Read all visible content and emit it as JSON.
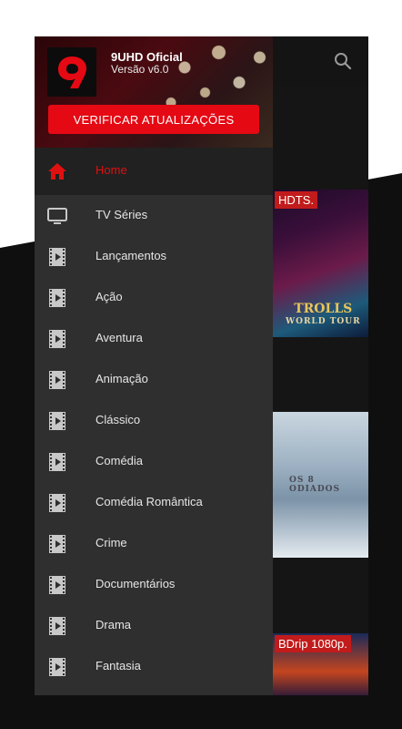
{
  "app": {
    "name": "9UHD Oficial",
    "version": "Versão v6.0",
    "update_button": "VERIFICAR ATUALIZAÇÕES"
  },
  "menu": {
    "items": [
      {
        "label": "Home",
        "icon": "home-icon",
        "active": true
      },
      {
        "label": "TV Séries",
        "icon": "tv-icon"
      },
      {
        "label": "Lançamentos",
        "icon": "film-icon"
      },
      {
        "label": "Ação",
        "icon": "film-icon"
      },
      {
        "label": "Aventura",
        "icon": "film-icon"
      },
      {
        "label": "Animação",
        "icon": "film-icon"
      },
      {
        "label": "Clássico",
        "icon": "film-icon"
      },
      {
        "label": "Comédia",
        "icon": "film-icon"
      },
      {
        "label": "Comédia Romântica",
        "icon": "film-icon"
      },
      {
        "label": "Crime",
        "icon": "film-icon"
      },
      {
        "label": "Documentários",
        "icon": "film-icon"
      },
      {
        "label": "Drama",
        "icon": "film-icon"
      },
      {
        "label": "Fantasia",
        "icon": "film-icon"
      }
    ]
  },
  "posters": [
    {
      "badge": "HDTS.",
      "title": "TROLLS",
      "subtitle": "WORLD TOUR"
    },
    {
      "badge": "",
      "title": "OS 8 ODIADOS"
    },
    {
      "badge": "BDrip 1080p."
    }
  ],
  "colors": {
    "accent": "#e50914",
    "active": "#e01010",
    "drawer_bg": "#2f2f2f"
  }
}
